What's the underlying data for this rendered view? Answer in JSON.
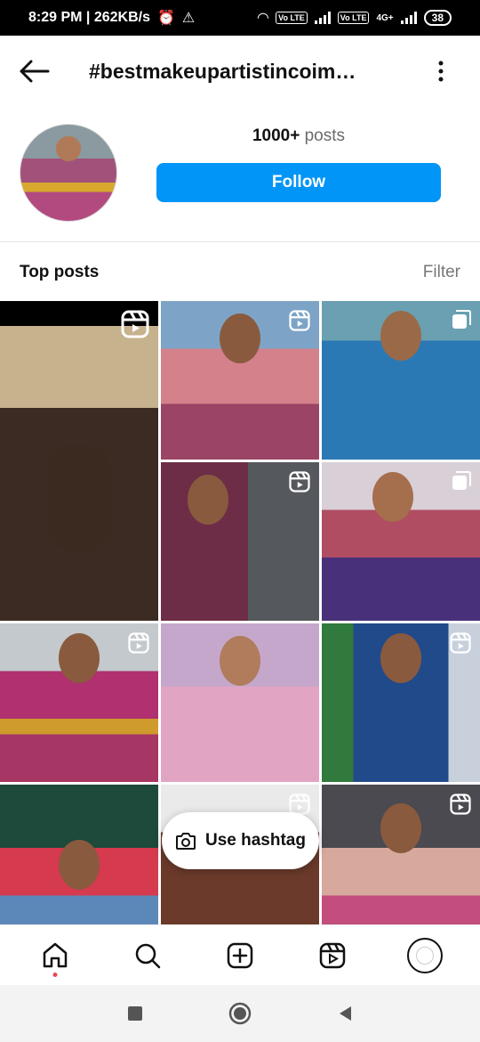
{
  "status_bar": {
    "time_speed": "8:29 PM | 262KB/s",
    "battery": "38",
    "lte1": "Vo LTE",
    "lte2": "Vo LTE",
    "net": "4G+"
  },
  "header": {
    "title": "#bestmakeupartistincoim…",
    "back_icon": "arrow-left-icon",
    "more_icon": "more-vertical-icon"
  },
  "profile": {
    "posts_count": "1000+",
    "posts_label": "posts",
    "follow_label": "Follow"
  },
  "section": {
    "title": "Top posts",
    "filter_label": "Filter"
  },
  "grid": {
    "tiles": [
      {
        "badge": "reel-icon"
      },
      {
        "badge": "reel-icon"
      },
      {
        "badge": "carousel-icon"
      },
      {
        "badge": "reel-icon"
      },
      {
        "badge": "carousel-icon"
      },
      {
        "badge": "reel-icon"
      },
      {
        "badge": "reel-icon"
      },
      {
        "badge": "reel-icon"
      },
      {
        "badge": "reel-icon"
      },
      {
        "badge": "reel-icon"
      },
      {
        "badge": "reel-icon"
      }
    ]
  },
  "use_hashtag": {
    "label": "Use hashtag",
    "icon": "camera-icon"
  },
  "bottom_nav": {
    "items": [
      "home-icon",
      "search-icon",
      "create-icon",
      "reels-icon",
      "profile-avatar"
    ],
    "active_dot_color": "#ed4956"
  },
  "colors": {
    "accent": "#0095f6"
  }
}
